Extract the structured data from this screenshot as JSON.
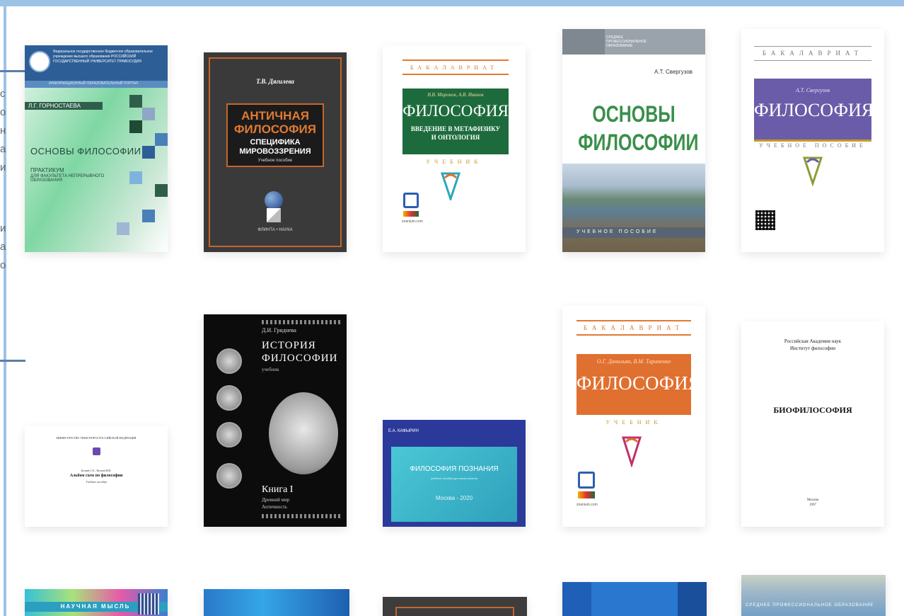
{
  "side_text": [
    "с",
    "о",
    "н",
    "а",
    "и",
    "и",
    "а",
    "о"
  ],
  "books": [
    {
      "org": "Федеральное государственное бюджетное образовательное учреждение высшего образования РОССИЙСКИЙ ГОСУДАРСТВЕННЫЙ УНИВЕРСИТЕТ ПРАВОСУДИЯ",
      "portal": "ИНФОРМАЦИОННЫЙ ОБРАЗОВАТЕЛЬНЫЙ ПОРТАЛ",
      "author": "Л.Г. ГОРНОСТАЕВА",
      "title": "ОСНОВЫ ФИЛОСОФИИ",
      "sub1": "ПРАКТИКУМ",
      "sub2": "ДЛЯ ФАКУЛЬТЕТА НЕПРЕРЫВНОГО ОБРАЗОВАНИЯ"
    },
    {
      "author": "Т.В. Дягилева",
      "title1": "АНТИЧНАЯ",
      "title2": "ФИЛОСОФИЯ",
      "sub1": "СПЕЦИФИКА",
      "sub2": "МИРОВОЗЗРЕНИЯ",
      "kind": "Учебное пособие",
      "pub": "ФЛИНТА • НАУКА"
    },
    {
      "series": "БАКАЛАВРИАТ",
      "author": "В.В. Миронов, А.В. Иванов",
      "title": "ФИЛОСОФИЯ",
      "sub1": "ВВЕДЕНИЕ В МЕТАФИЗИКУ",
      "sub2": "И ОНТОЛОГИЯ",
      "kind": "УЧЕБНИК",
      "site": "znanium.com"
    },
    {
      "series": "СРЕДНЕЕ ПРОФЕССИОНАЛЬНОЕ ОБРАЗОВАНИЕ",
      "author": "А.Т. Свергузов",
      "title1": "ОСНОВЫ",
      "title2": "ФИЛОСОФИИ",
      "kind": "УЧЕБНОЕ ПОСОБИЕ"
    },
    {
      "series": "БАКАЛАВРИАТ",
      "author": "А.Т. Свергузов",
      "title": "ФИЛОСОФИЯ",
      "kind": "УЧЕБНОЕ ПОСОБИЕ"
    },
    {
      "org": "МИНИСТЕРСТВО ТРАНСПОРТА РОССИЙСКОЙ ФЕДЕРАЦИИ",
      "authors": "Беляев С.Е., Козлов И.И.",
      "title": "Альбом схем по философии",
      "kind": "Учебное пособие"
    },
    {
      "author": "Д.И. Гриднева",
      "title1": "ИСТОРИЯ",
      "title2": "ФИЛОСОФИИ",
      "kind": "учебник",
      "book": "Книга I",
      "sub1": "Древний мир",
      "sub2": "Античность"
    },
    {
      "author": "Е.А. КАФЫРИН",
      "title": "ФИЛОСОФИЯ ПОЗНАНИЯ",
      "sub": "учебное пособие для магистрантов",
      "city": "Москва - 2020"
    },
    {
      "series": "БАКАЛАВРИАТ",
      "author": "О.Г. Данильян, В.М. Тараненко",
      "title": "ФИЛОСОФИЯ",
      "kind": "УЧЕБНИК",
      "site": "znanium.com"
    },
    {
      "org1": "Российская Академия наук",
      "org2": "Институт философии",
      "title": "БИОФИЛОСОФИЯ",
      "city": "Москва",
      "year": "1997"
    },
    {
      "series": "НАУЧНАЯ МЫСЛЬ"
    },
    {},
    {},
    {},
    {
      "series": "СРЕДНЕЕ ПРОФЕССИОНАЛЬНОЕ ОБРАЗОВАНИЕ"
    }
  ],
  "colors": {
    "frame": "#9cc3e6",
    "green": "#1d6b3c",
    "purple": "#6a5ca8",
    "orange": "#e07030",
    "teal": "#3fb8c8"
  }
}
